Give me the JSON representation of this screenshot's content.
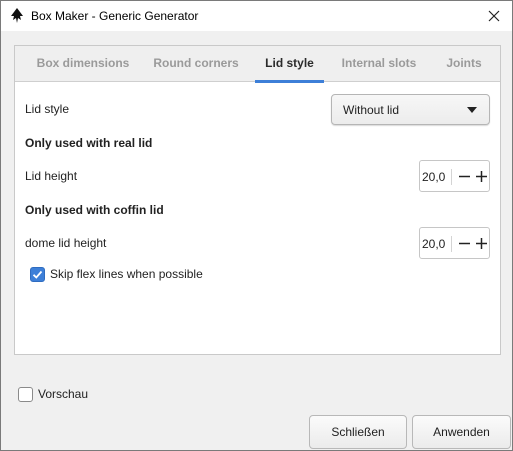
{
  "window": {
    "title": "Box Maker - Generic Generator"
  },
  "tabs": [
    {
      "label": "Box dimensions",
      "active": false
    },
    {
      "label": "Round corners",
      "active": false
    },
    {
      "label": "Lid style",
      "active": true
    },
    {
      "label": "Internal slots",
      "active": false
    },
    {
      "label": "Joints",
      "active": false
    }
  ],
  "lid_style": {
    "label": "Lid style",
    "selected": "Without lid"
  },
  "real_lid": {
    "section": "Only used with real lid",
    "height_label": "Lid height",
    "height_value": "20,0"
  },
  "coffin_lid": {
    "section": "Only used with coffin lid",
    "dome_label": "dome lid height",
    "dome_value": "20,0"
  },
  "skip_flex": {
    "label": "Skip flex lines when possible",
    "checked": true
  },
  "preview": {
    "label": "Vorschau",
    "checked": false
  },
  "buttons": {
    "close": "Schließen",
    "apply": "Anwenden"
  },
  "colors": {
    "accent": "#3d7fd8"
  },
  "icons": {
    "app": "inkscape-icon",
    "close": "close-icon",
    "dropdown": "caret-down-icon",
    "minus": "minus-icon",
    "plus": "plus-icon",
    "check": "checkmark-icon"
  }
}
